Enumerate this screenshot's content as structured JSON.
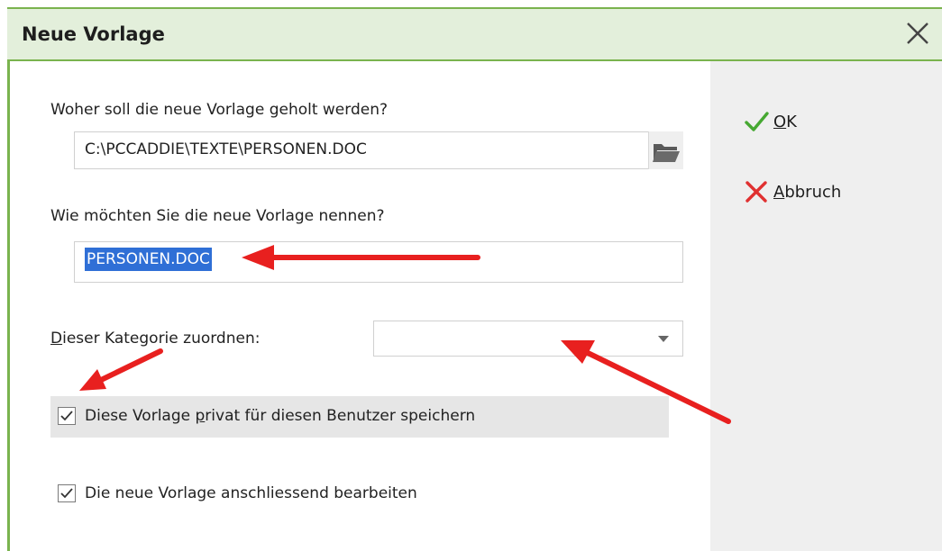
{
  "dialog": {
    "title": "Neue Vorlage"
  },
  "source": {
    "label": "Woher soll die neue Vorlage geholt werden?",
    "value": "C:\\PCCADDIE\\TEXTE\\PERSONEN.DOC"
  },
  "name": {
    "label": "Wie möchten Sie die neue Vorlage nennen?",
    "value": "PERSONEN.DOC"
  },
  "category": {
    "label_first": "D",
    "label_rest": "ieser Kategorie zuordnen:",
    "selected": ""
  },
  "private_checkbox": {
    "label_before": "Diese Vorlage ",
    "label_underlined": "p",
    "label_after": "rivat für diesen Benutzer speichern",
    "checked": true
  },
  "edit_checkbox": {
    "label": "Die neue Vorlage anschliessend bearbeiten",
    "checked": true
  },
  "actions": {
    "ok_first": "O",
    "ok_rest": "K",
    "cancel_first": "A",
    "cancel_rest": "bbruch"
  },
  "colors": {
    "title_bg": "#e3efdb",
    "accent_green": "#7ab34e",
    "selection_blue": "#2f6fd6",
    "annotation_red": "#e8201f"
  },
  "icons": {
    "close": "close-icon",
    "folder": "folder-icon",
    "ok": "checkmark-icon",
    "cancel": "cross-icon",
    "dropdown": "chevron-down-icon"
  }
}
